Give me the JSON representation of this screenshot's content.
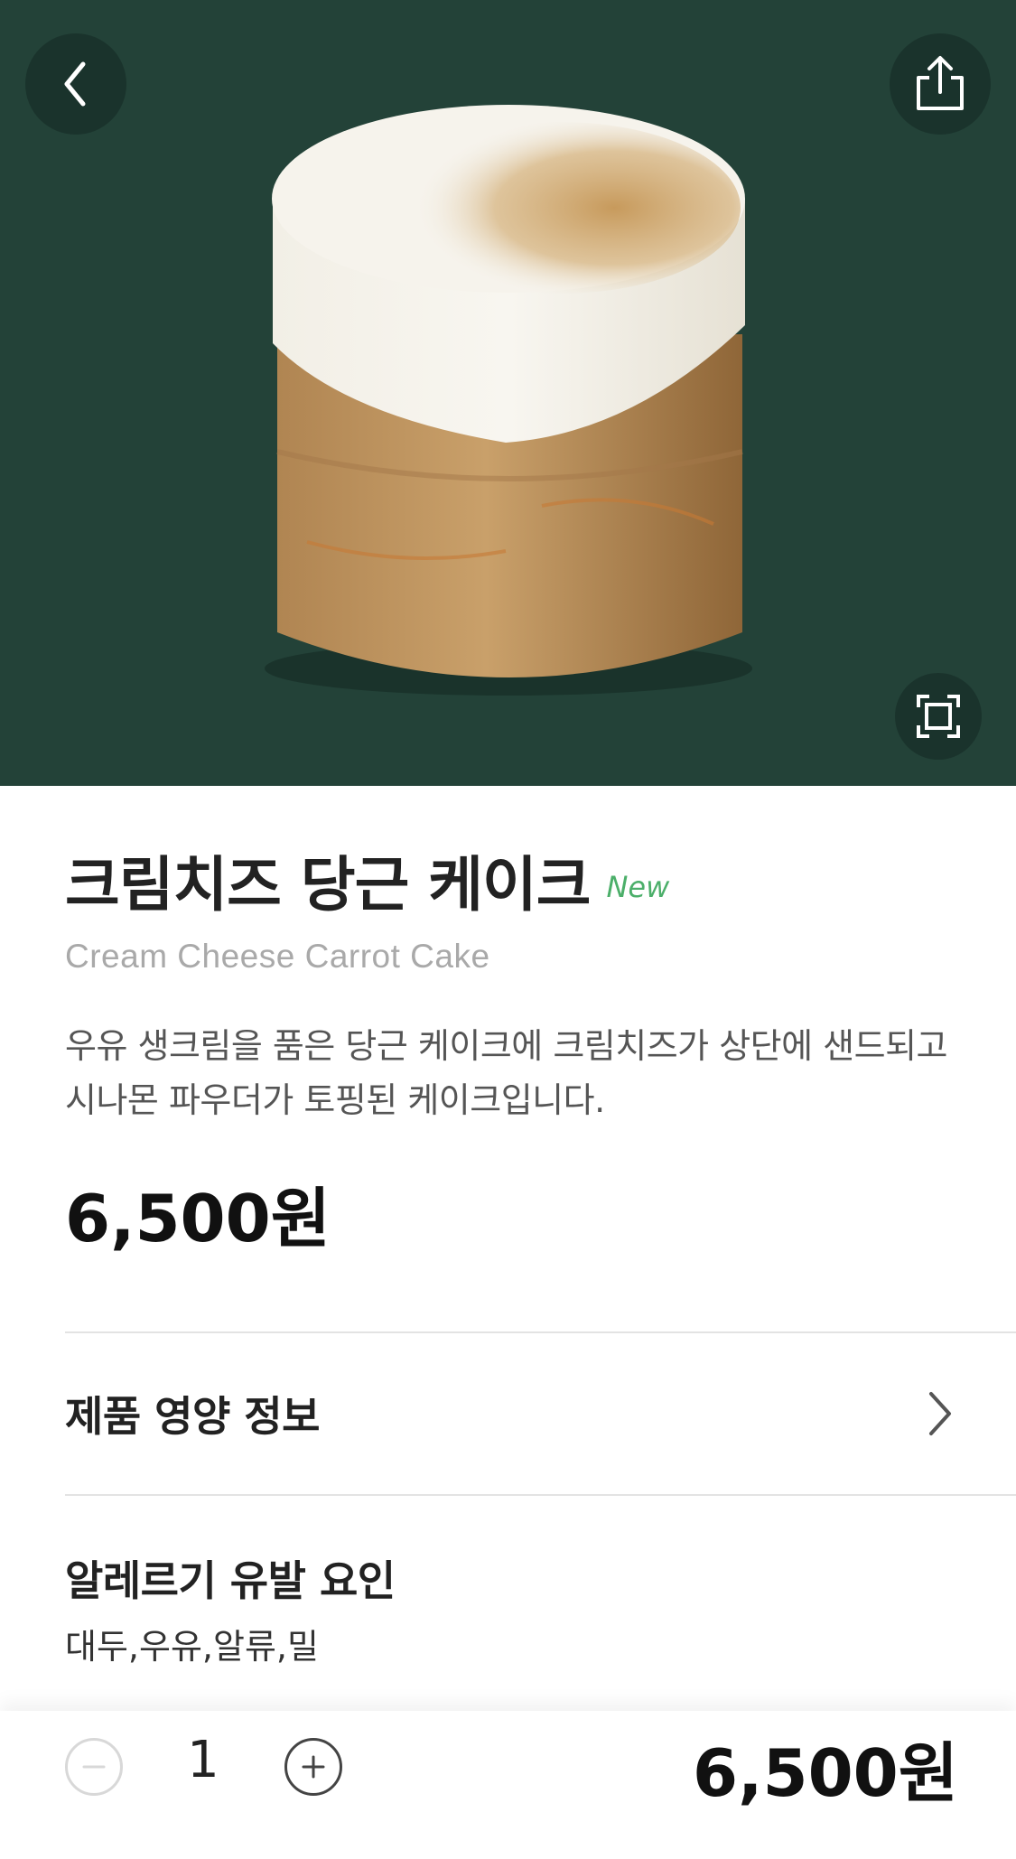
{
  "product": {
    "name_ko": "크림치즈 당근 케이크",
    "badge": "New",
    "name_en": "Cream Cheese Carrot Cake",
    "description": "우유 생크림을 품은 당근 케이크에 크림치즈가 상단에 샌드되고 시나몬 파우더가 토핑된 케이크입니다.",
    "price": "6,500원"
  },
  "sections": {
    "nutrition_label": "제품 영양 정보",
    "allergy_title": "알레르기 유발 요인",
    "allergy_values": "대두,우유,알류,밀"
  },
  "order_bar": {
    "quantity": "1",
    "total_price": "6,500원"
  },
  "icons": {
    "back": "chevron-left-icon",
    "share": "share-icon",
    "zoom": "fullscreen-icon",
    "nutrition_arrow": "chevron-right-icon",
    "minus": "minus-icon",
    "plus": "plus-icon"
  },
  "colors": {
    "hero_background": "#234238",
    "badge_green": "#4caf6a"
  }
}
